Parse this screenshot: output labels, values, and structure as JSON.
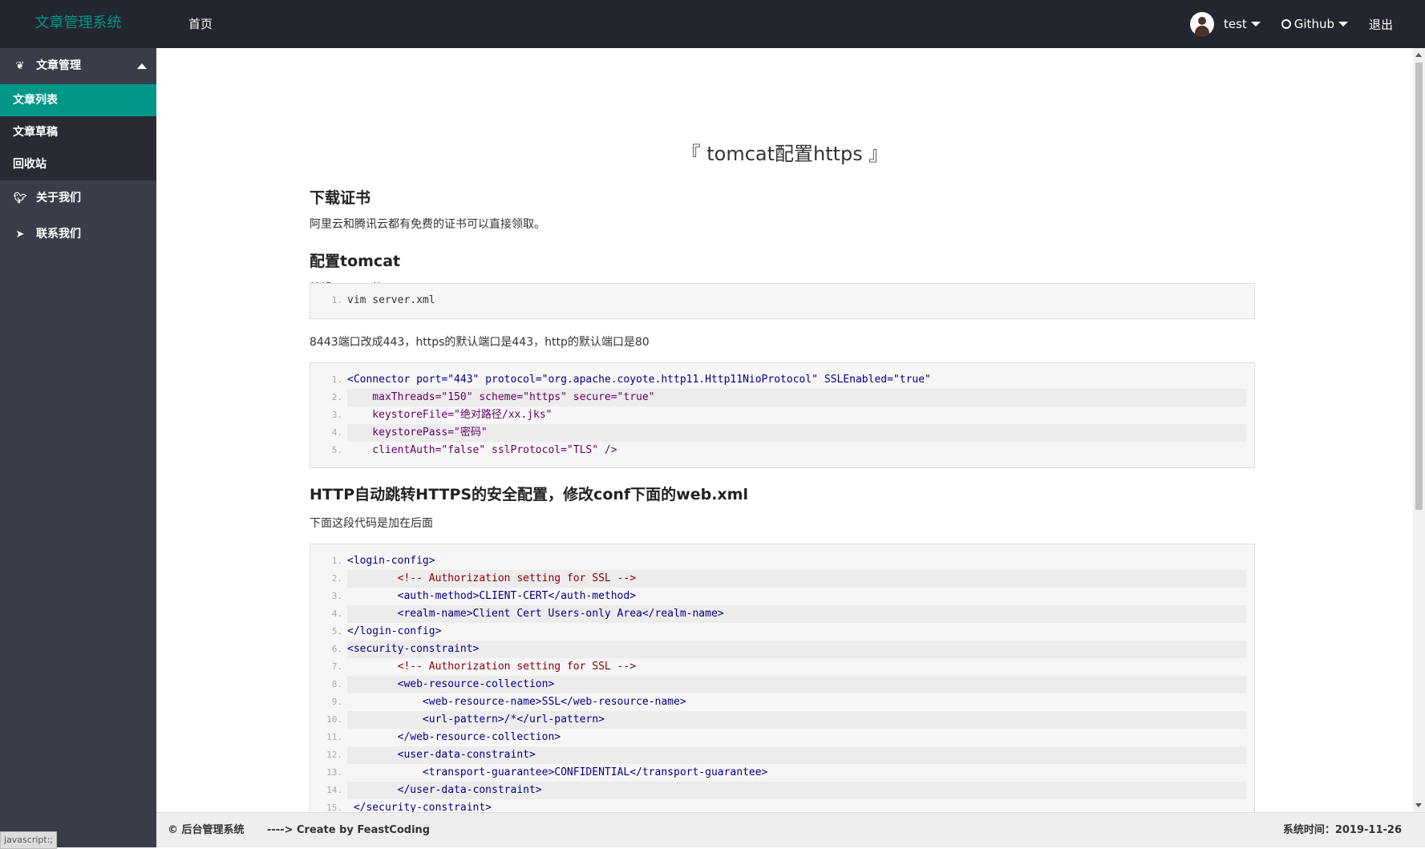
{
  "app": {
    "title": "文章管理系统"
  },
  "topnav": {
    "home": "首页",
    "user": "test",
    "github": "Github",
    "logout": "退出"
  },
  "sidebar": {
    "group_article": "文章管理",
    "items": [
      "文章列表",
      "文章草稿",
      "回收站"
    ],
    "active_index": 0,
    "about": "关于我们",
    "contact": "联系我们"
  },
  "article": {
    "title": "『 tomcat配置https 』",
    "sections": [
      {
        "heading": "下载证书",
        "text": "阿里云和腾讯云都有免费的证书可以直接领取。"
      },
      {
        "heading": "配置tomcat",
        "text": "编辑tomcat的server.xml"
      },
      {
        "text": "8443端口改成443，https的默认端口是443，http的默认端口是80"
      },
      {
        "heading": "HTTP自动跳转HTTPS的安全配置，修改conf下面的web.xml",
        "text": "下面这段代码是加在后面"
      }
    ],
    "code_blocks": [
      {
        "lines": [
          {
            "n": "1.",
            "text": "vim server.xml"
          }
        ]
      },
      {
        "lines": [
          {
            "n": "1.",
            "text": "<Connector port=\"443\" protocol=\"org.apache.coyote.http11.Http11NioProtocol\" SSLEnabled=\"true\""
          },
          {
            "n": "2.",
            "text": "    maxThreads=\"150\" scheme=\"https\" secure=\"true\""
          },
          {
            "n": "3.",
            "text": "    keystoreFile=\"绝对路径/xx.jks\""
          },
          {
            "n": "4.",
            "text": "    keystorePass=\"密码\""
          },
          {
            "n": "5.",
            "text": "    clientAuth=\"false\" sslProtocol=\"TLS\" />"
          }
        ]
      },
      {
        "lines": [
          {
            "n": "1.",
            "text": "<login-config>"
          },
          {
            "n": "2.",
            "text": "        <!-- Authorization setting for SSL -->"
          },
          {
            "n": "3.",
            "text": "        <auth-method>CLIENT-CERT</auth-method>"
          },
          {
            "n": "4.",
            "text": "        <realm-name>Client Cert Users-only Area</realm-name>"
          },
          {
            "n": "5.",
            "text": "</login-config>"
          },
          {
            "n": "6.",
            "text": "<security-constraint>"
          },
          {
            "n": "7.",
            "text": "        <!-- Authorization setting for SSL -->"
          },
          {
            "n": "8.",
            "text": "        <web-resource-collection>"
          },
          {
            "n": "9.",
            "text": "            <web-resource-name>SSL</web-resource-name>"
          },
          {
            "n": "10.",
            "text": "            <url-pattern>/*</url-pattern>"
          },
          {
            "n": "11.",
            "text": "        </web-resource-collection>"
          },
          {
            "n": "12.",
            "text": "        <user-data-constraint>"
          },
          {
            "n": "13.",
            "text": "            <transport-guarantee>CONFIDENTIAL</transport-guarantee>"
          },
          {
            "n": "14.",
            "text": "        </user-data-constraint>"
          },
          {
            "n": "15.",
            "text": " </security-constraint>"
          }
        ]
      }
    ]
  },
  "footer": {
    "copyright": "© 后台管理系统",
    "create": "----> Create by FeastCoding",
    "system_time_label": "系统时间：",
    "system_time": "2019-11-26"
  },
  "status_tip": "javascript:;",
  "colors": {
    "accent": "#009688",
    "topbar": "#23262e",
    "sidebar": "#393d49"
  }
}
